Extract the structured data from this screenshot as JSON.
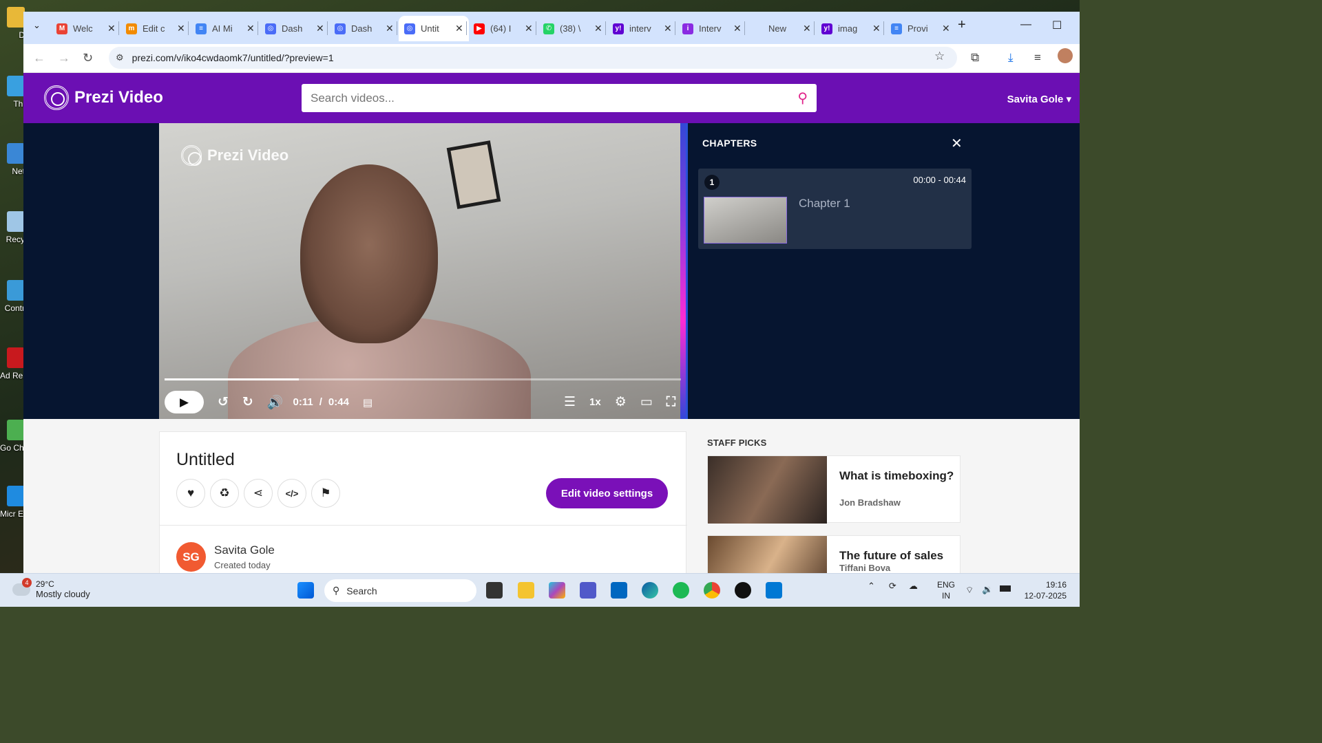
{
  "browser": {
    "tabs": [
      {
        "title": "Welc",
        "color": "#ea4335",
        "glyph": "M"
      },
      {
        "title": "Edit c",
        "color": "#f28b00",
        "glyph": "m"
      },
      {
        "title": "AI Mi",
        "color": "#4285f4",
        "glyph": "≡"
      },
      {
        "title": "Dash",
        "color": "#4a6cf7",
        "glyph": "◎"
      },
      {
        "title": "Dash",
        "color": "#4a6cf7",
        "glyph": "◎"
      },
      {
        "title": "Untit",
        "color": "#4a6cf7",
        "glyph": "◎"
      },
      {
        "title": "(64) I",
        "color": "#ff0000",
        "glyph": "▶"
      },
      {
        "title": "(38) \\",
        "color": "#25d366",
        "glyph": "✆"
      },
      {
        "title": "interv",
        "color": "#6001d2",
        "glyph": "y!"
      },
      {
        "title": "Interv",
        "color": "#8a2be2",
        "glyph": "i"
      },
      {
        "title": "New",
        "color": "#d3e3fd",
        "glyph": ""
      },
      {
        "title": "imag",
        "color": "#6001d2",
        "glyph": "y!"
      },
      {
        "title": "Provi",
        "color": "#4285f4",
        "glyph": "≡"
      }
    ],
    "active_tab_index": 5,
    "url": "prezi.com/v/iko4cwdaomk7/untitled/?preview=1"
  },
  "prezi": {
    "logo_text": "Prezi Video",
    "search_placeholder": "Search videos...",
    "user_name": "Savita Gole"
  },
  "player": {
    "watermark": "Prezi Video",
    "current_time": "0:11",
    "separator": "/",
    "duration": "0:44",
    "progress_fraction": 0.26,
    "speed": "1x",
    "rewind_label": "5",
    "forward_label": "5"
  },
  "chapters": {
    "heading": "CHAPTERS",
    "items": [
      {
        "number": "1",
        "time_range": "00:00 - 00:44",
        "title": "Chapter 1"
      }
    ]
  },
  "video_info": {
    "title": "Untitled",
    "edit_button": "Edit video settings",
    "avatar_initials": "SG",
    "author": "Savita Gole",
    "created": "Created today"
  },
  "staff_picks": {
    "heading": "STAFF PICKS",
    "items": [
      {
        "title": "What is timeboxing?",
        "author": "Jon Bradshaw"
      },
      {
        "title": "The future of sales",
        "author": "Tiffani Bova"
      }
    ]
  },
  "desktop_icons": [
    "D",
    "Thi",
    "Net",
    "Recy",
    "Contr",
    "Ad Read",
    "Go Chr",
    "Micr Ec"
  ],
  "taskbar": {
    "weather_temp": "29°C",
    "weather_desc": "Mostly cloudy",
    "weather_badge": "4",
    "search_label": "Search",
    "lang_line1": "ENG",
    "lang_line2": "IN",
    "time": "19:16",
    "date": "12-07-2025"
  }
}
